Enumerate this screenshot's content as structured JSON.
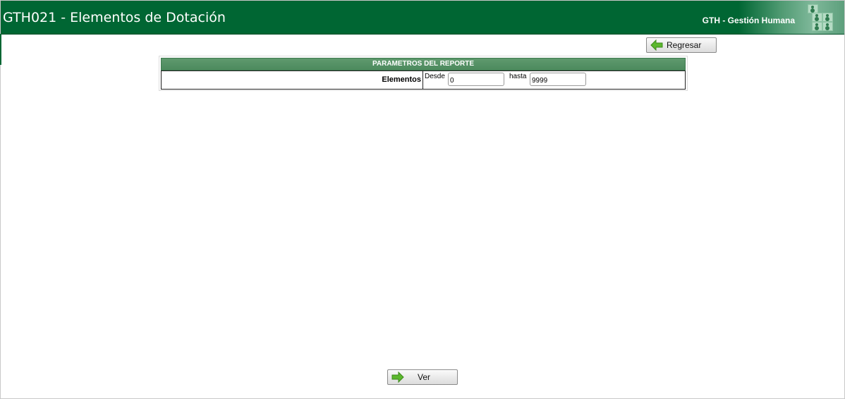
{
  "header": {
    "title": "GTH021 - Elementos de Dotación",
    "app_name": "GTH - Gestión Humana"
  },
  "buttons": {
    "regresar_label": "Regresar",
    "ver_label": "Ver"
  },
  "report_params": {
    "heading": "PARAMETROS DEL REPORTE",
    "row_label": "Elementos",
    "desde_label": "Desde",
    "desde_value": "0",
    "hasta_label": "hasta",
    "hasta_value": "9999"
  },
  "icons": {
    "back": "arrow-left-icon",
    "view": "arrow-right-icon"
  },
  "colors": {
    "header_bg": "#006633",
    "table_head_bg": "#4c8a5d",
    "arrow_green": "#5cb82e"
  }
}
